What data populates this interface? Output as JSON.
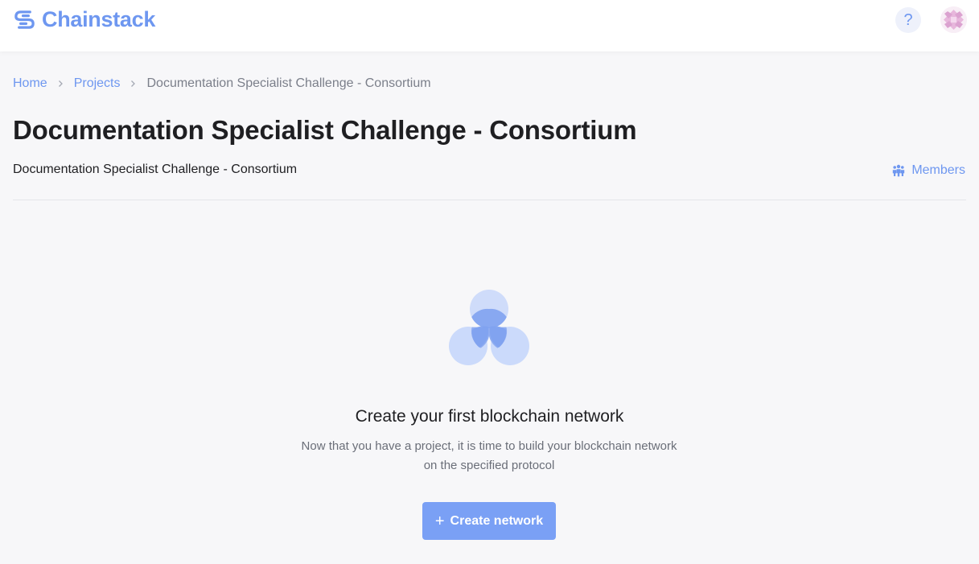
{
  "app": {
    "brand": "Chainstack",
    "accent_color": "#6e97f0",
    "help_icon": "question-icon",
    "help_label": "?"
  },
  "breadcrumb": {
    "items": [
      {
        "label": "Home"
      },
      {
        "label": "Projects"
      }
    ],
    "current": "Documentation Specialist Challenge - Consortium",
    "separator_icon": "chevron-right-icon"
  },
  "project": {
    "title": "Documentation Specialist Challenge - Consortium",
    "description": "Documentation Specialist Challenge - Consortium",
    "members_label": "Members",
    "members_icon": "members-icon"
  },
  "empty_state": {
    "illustration_icon": "network-circles-icon",
    "title": "Create your first blockchain network",
    "description_line1": "Now that you have a project, it is time to build your blockchain network",
    "description_line2": "on the specified protocol",
    "button_label": "Create network",
    "button_icon": "plus-icon",
    "button_color": "#7aa0f5"
  }
}
